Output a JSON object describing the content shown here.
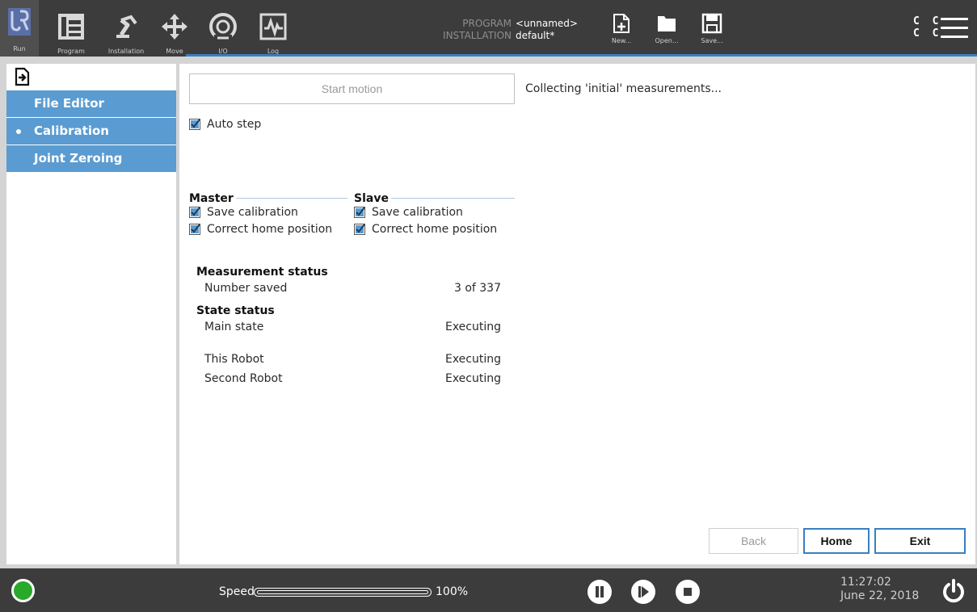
{
  "topbar": {
    "nav": [
      {
        "label": "Run",
        "icon": "ur-logo-icon"
      },
      {
        "label": "Program",
        "icon": "program-icon"
      },
      {
        "label": "Installation",
        "icon": "robot-arm-icon"
      },
      {
        "label": "Move",
        "icon": "move-arrows-icon"
      },
      {
        "label": "I/O",
        "icon": "io-icon"
      },
      {
        "label": "Log",
        "icon": "log-icon"
      }
    ],
    "program_key": "PROGRAM",
    "program_value": "<unnamed>",
    "installation_key": "INSTALLATION",
    "installation_value": "default*",
    "file_buttons": [
      {
        "label": "New...",
        "icon": "new-file-icon"
      },
      {
        "label": "Open...",
        "icon": "folder-icon"
      },
      {
        "label": "Save...",
        "icon": "save-icon"
      }
    ],
    "cc_top": "C C",
    "cc_bottom": "C C",
    "menu_icon": "hamburger-menu-icon",
    "accent_color": "#3a7fbf"
  },
  "sidebar": {
    "exit_icon": "exit-door-icon",
    "items": [
      {
        "label": "File Editor",
        "selected": false
      },
      {
        "label": "Calibration",
        "selected": true
      },
      {
        "label": "Joint Zeroing",
        "selected": false
      }
    ],
    "item_color": "#5a9bd1"
  },
  "main": {
    "start_motion_label": "Start motion",
    "collecting_text": "Collecting 'initial' measurements...",
    "auto_step_label": "Auto step",
    "auto_step_checked": true,
    "master": {
      "title": "Master",
      "save_calibration_label": "Save calibration",
      "save_calibration_checked": true,
      "correct_home_label": "Correct home position",
      "correct_home_checked": true
    },
    "slave": {
      "title": "Slave",
      "save_calibration_label": "Save calibration",
      "save_calibration_checked": true,
      "correct_home_label": "Correct home position",
      "correct_home_checked": true
    },
    "measurement_status_title": "Measurement status",
    "number_saved_label": "Number saved",
    "number_saved_value": "3 of 337",
    "state_status_title": "State status",
    "main_state_label": "Main state",
    "main_state_value": "Executing",
    "this_robot_label": "This Robot",
    "this_robot_value": "Executing",
    "second_robot_label": "Second Robot",
    "second_robot_value": "Executing",
    "back_label": "Back",
    "home_label": "Home",
    "exit_label": "Exit"
  },
  "footer": {
    "speed_label": "Speed",
    "speed_value": "100%",
    "speed_fraction": 1.0,
    "status_color": "#2aa82a",
    "controls": [
      "pause-icon",
      "step-icon",
      "stop-icon"
    ],
    "time": "11:27:02",
    "date": "June 22, 2018",
    "power_icon": "power-icon"
  }
}
